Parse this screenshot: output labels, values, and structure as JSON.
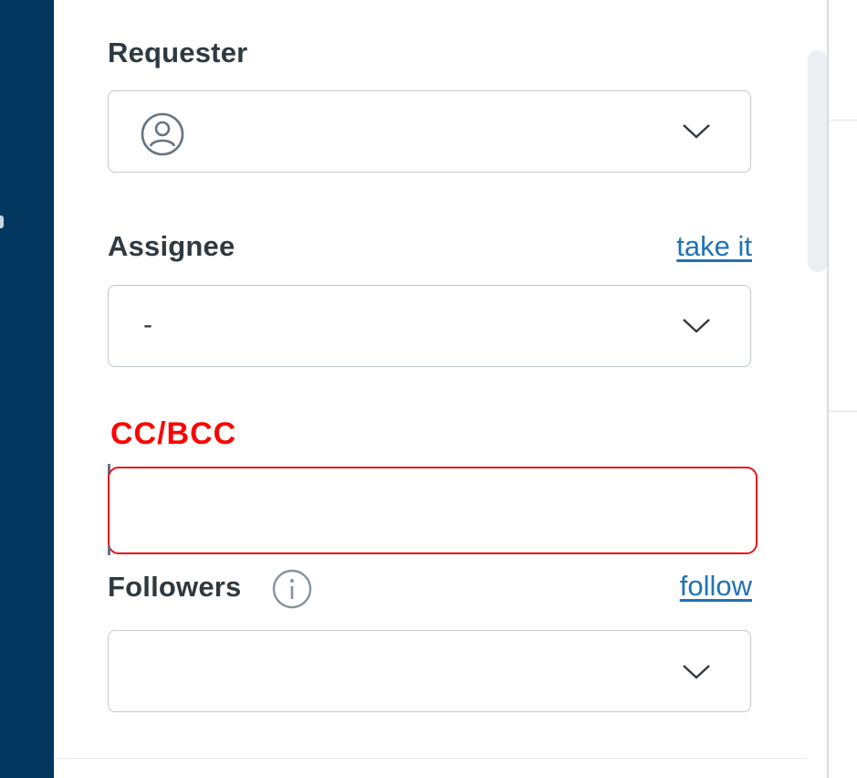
{
  "requester": {
    "label": "Requester",
    "icon": "user-avatar-icon",
    "value": ""
  },
  "assignee": {
    "label": "Assignee",
    "action_link": "take it",
    "value": "-"
  },
  "cc": {
    "label": "CC/BCC",
    "value": ""
  },
  "followers": {
    "label": "Followers",
    "action_link": "follow",
    "info_icon": "info-icon",
    "value": ""
  },
  "colors": {
    "nav_rail": "#04375f",
    "link": "#1f73b7",
    "highlight": "#ff0000"
  }
}
